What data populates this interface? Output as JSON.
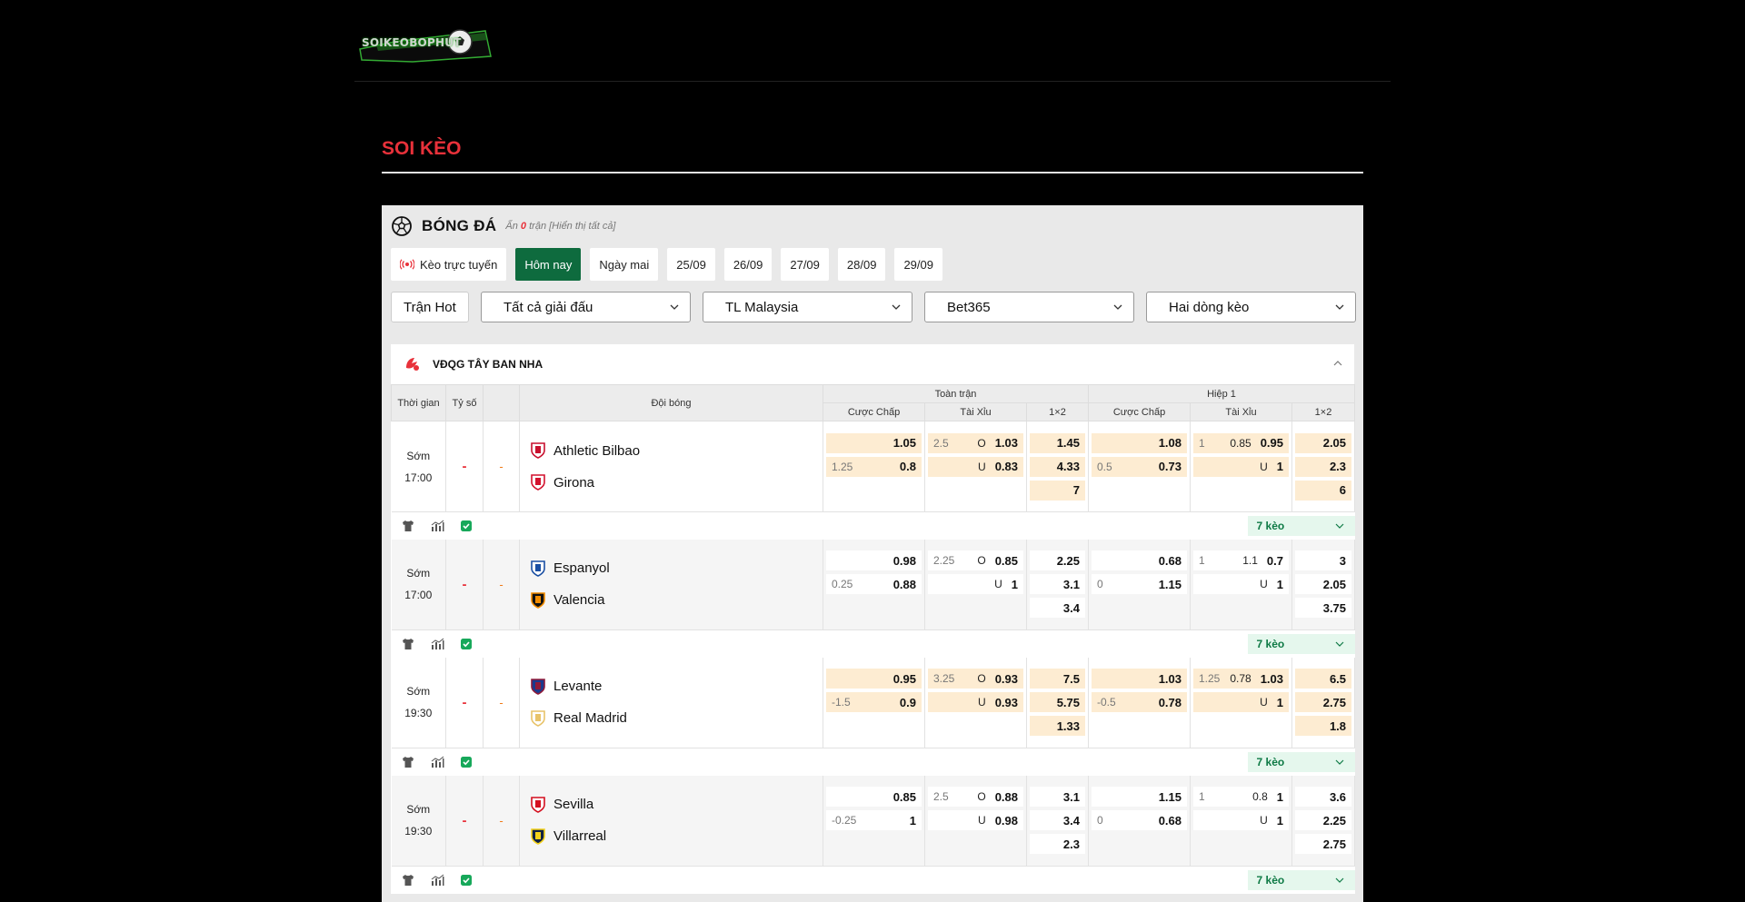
{
  "header": {
    "logo_text": "SOIKEOBOPHUT"
  },
  "section": {
    "title": "SOI KÈO"
  },
  "sport": {
    "title": "BÓNG ĐÁ",
    "hidden_prefix": "Ẩn",
    "hidden_count": "0",
    "hidden_suffix": "trận [Hiển thị tất cả]"
  },
  "tabs": [
    {
      "label": "Kèo trực tuyến"
    },
    {
      "label": "Hôm nay"
    },
    {
      "label": "Ngày mai"
    },
    {
      "label": "25/09"
    },
    {
      "label": "26/09"
    },
    {
      "label": "27/09"
    },
    {
      "label": "28/09"
    },
    {
      "label": "29/09"
    }
  ],
  "filters": {
    "hot": "Trận Hot",
    "league": "Tất cả giải đấu",
    "odds_type": "TL Malaysia",
    "bookmaker": "Bet365",
    "lines": "Hai dòng kèo"
  },
  "league": {
    "name": "VĐQG TÂY BAN NHA"
  },
  "table_head": {
    "time": "Thời gian",
    "score": "Tỷ số",
    "teams": "Đội bóng",
    "full": "Toàn trận",
    "half": "Hiệp 1",
    "handicap": "Cược Chấp",
    "ou": "Tài Xỉu",
    "x12": "1×2"
  },
  "more_label": "7 kèo",
  "matches": [
    {
      "status": "Sớm",
      "time": "17:00",
      "score": "-",
      "score_ht": "-",
      "shade": "white",
      "home": "Athletic Bilbao",
      "away": "Girona",
      "full": {
        "hdp": [
          [
            "",
            "1.05"
          ],
          [
            "1.25",
            "0.8"
          ]
        ],
        "ou": [
          [
            "2.5",
            "O",
            "1.03"
          ],
          [
            "",
            "U",
            "0.83"
          ]
        ],
        "x12": [
          "1.45",
          "4.33",
          "7"
        ]
      },
      "half": {
        "hdp": [
          [
            "",
            "1.08"
          ],
          [
            "0.5",
            "0.73"
          ]
        ],
        "ou": [
          [
            "1",
            "0.85",
            "0.95"
          ],
          [
            "",
            "U",
            "1"
          ]
        ],
        "x12": [
          "2.05",
          "2.3",
          "6"
        ]
      },
      "hl": true
    },
    {
      "status": "Sớm",
      "time": "17:00",
      "score": "-",
      "score_ht": "-",
      "shade": "alt",
      "home": "Espanyol",
      "away": "Valencia",
      "full": {
        "hdp": [
          [
            "",
            "0.98"
          ],
          [
            "0.25",
            "0.88"
          ]
        ],
        "ou": [
          [
            "2.25",
            "O",
            "0.85"
          ],
          [
            "",
            "U",
            "1"
          ]
        ],
        "x12": [
          "2.25",
          "3.1",
          "3.4"
        ]
      },
      "half": {
        "hdp": [
          [
            "",
            "0.68"
          ],
          [
            "0",
            "1.15"
          ]
        ],
        "ou": [
          [
            "1",
            "1.1",
            "0.7"
          ],
          [
            "",
            "U",
            "1"
          ]
        ],
        "x12": [
          "3",
          "2.05",
          "3.75"
        ]
      },
      "hl": false
    },
    {
      "status": "Sớm",
      "time": "19:30",
      "score": "-",
      "score_ht": "-",
      "shade": "white",
      "home": "Levante",
      "away": "Real Madrid",
      "full": {
        "hdp": [
          [
            "",
            "0.95"
          ],
          [
            "-1.5",
            "0.9"
          ]
        ],
        "ou": [
          [
            "3.25",
            "O",
            "0.93"
          ],
          [
            "",
            "U",
            "0.93"
          ]
        ],
        "x12": [
          "7.5",
          "5.75",
          "1.33"
        ]
      },
      "half": {
        "hdp": [
          [
            "",
            "1.03"
          ],
          [
            "-0.5",
            "0.78"
          ]
        ],
        "ou": [
          [
            "1.25",
            "0.78",
            "1.03"
          ],
          [
            "",
            "U",
            "1"
          ]
        ],
        "x12": [
          "6.5",
          "2.75",
          "1.8"
        ]
      },
      "hl": true
    },
    {
      "status": "Sớm",
      "time": "19:30",
      "score": "-",
      "score_ht": "-",
      "shade": "alt",
      "home": "Sevilla",
      "away": "Villarreal",
      "full": {
        "hdp": [
          [
            "",
            "0.85"
          ],
          [
            "-0.25",
            "1"
          ]
        ],
        "ou": [
          [
            "2.5",
            "O",
            "0.88"
          ],
          [
            "",
            "U",
            "0.98"
          ]
        ],
        "x12": [
          "3.1",
          "3.4",
          "2.3"
        ]
      },
      "half": {
        "hdp": [
          [
            "",
            "1.15"
          ],
          [
            "0",
            "0.68"
          ]
        ],
        "ou": [
          [
            "1",
            "0.8",
            "1"
          ],
          [
            "",
            "U",
            "1"
          ]
        ],
        "x12": [
          "3.6",
          "2.25",
          "2.75"
        ]
      },
      "hl": false
    }
  ],
  "colors": {
    "accent_red": "#e8313a",
    "brand_green": "#0e6b3e",
    "highlight": "#fdecd2"
  },
  "icons": [
    "soccer-ball-icon",
    "live-broadcast-icon",
    "chevron-down-icon",
    "laliga-logo-icon",
    "jersey-icon",
    "stats-icon",
    "check-icon",
    "chevron-up-icon"
  ]
}
